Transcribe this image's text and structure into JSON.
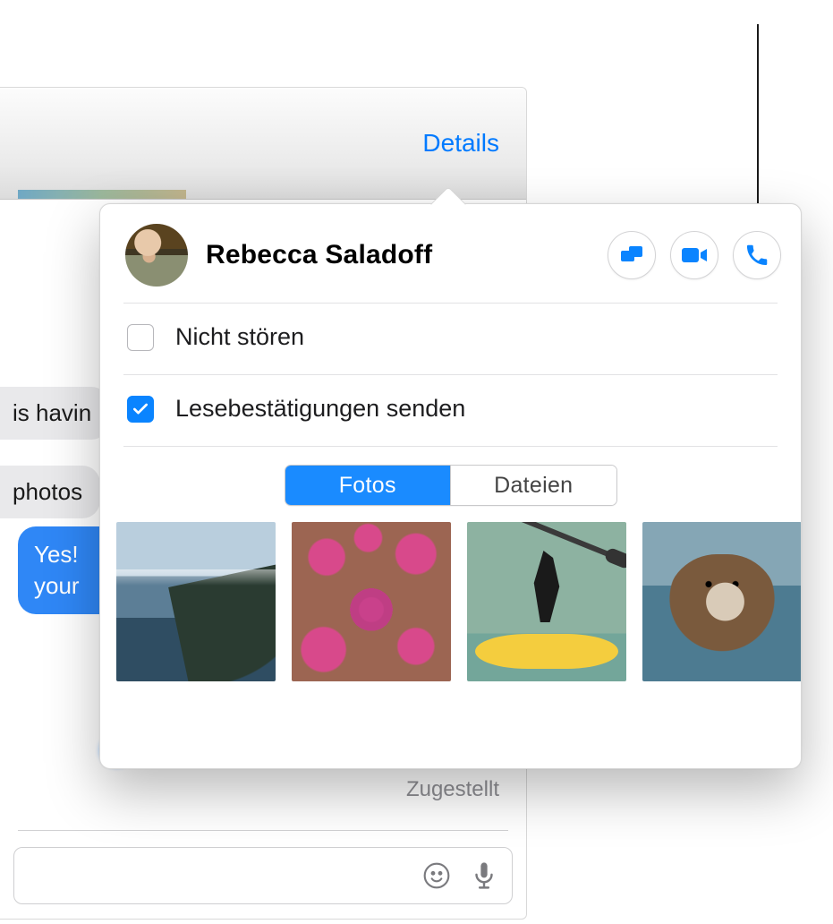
{
  "header": {
    "details_label": "Details"
  },
  "messages": {
    "incoming": [
      "is havin",
      "photos"
    ],
    "outgoing": "Yes! \nyour ",
    "delivered_label": "Zugestellt"
  },
  "popover": {
    "contact_name": "Rebecca Saladoff",
    "dnd_label": "Nicht stören",
    "read_receipts_label": "Lesebestätigungen senden",
    "dnd_checked": false,
    "read_receipts_checked": true,
    "segments": {
      "photos": "Fotos",
      "files": "Dateien",
      "active": "photos"
    },
    "thumbnails": [
      "coastline",
      "starfish",
      "kayaker",
      "otter"
    ]
  }
}
